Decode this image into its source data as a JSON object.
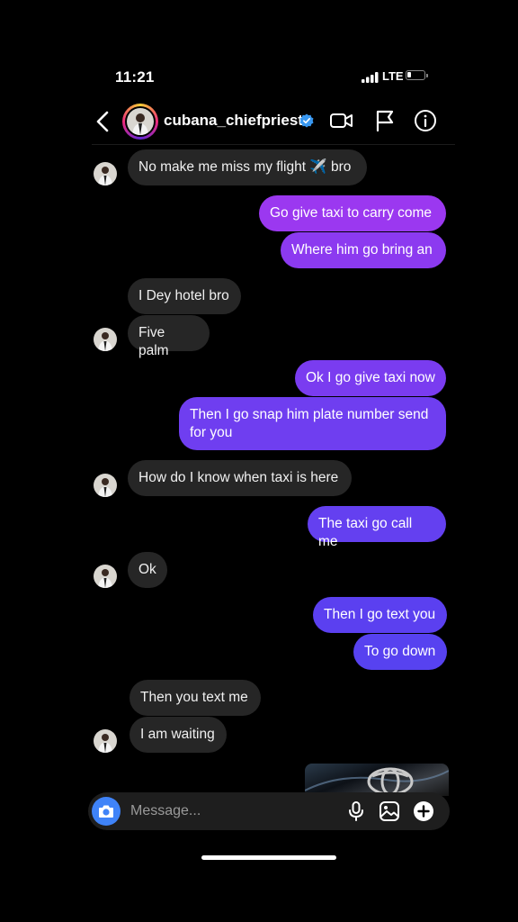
{
  "status_bar": {
    "time": "11:21",
    "network": "LTE"
  },
  "header": {
    "username": "cubana_chiefpriest"
  },
  "messages": [
    {
      "id": "m1",
      "dir": "in",
      "text": "No make me miss my flight ✈️ bro"
    },
    {
      "id": "m2",
      "dir": "out",
      "text": "Go give taxi to carry come"
    },
    {
      "id": "m3",
      "dir": "out",
      "text": "Where him go bring an"
    },
    {
      "id": "m4",
      "dir": "in",
      "text": "I Dey hotel bro"
    },
    {
      "id": "m5",
      "dir": "in",
      "text": "Five palm"
    },
    {
      "id": "m6",
      "dir": "out",
      "text": "Ok I go give taxi now"
    },
    {
      "id": "m7",
      "dir": "out",
      "text": "Then I go snap him plate number send for you"
    },
    {
      "id": "m8",
      "dir": "in",
      "text": "How do I know when taxi is here"
    },
    {
      "id": "m9",
      "dir": "out",
      "text": "The taxi go call me"
    },
    {
      "id": "m10",
      "dir": "in",
      "text": "Ok"
    },
    {
      "id": "m11",
      "dir": "out",
      "text": "Then I go text you"
    },
    {
      "id": "m12",
      "dir": "out",
      "text": "To go down"
    },
    {
      "id": "m13",
      "dir": "in",
      "text": "Then you text me"
    },
    {
      "id": "m14",
      "dir": "in",
      "text": "I am waiting"
    }
  ],
  "composer": {
    "placeholder": "Message..."
  },
  "colors": {
    "incoming": "#262626",
    "outgoing_top": "#a035f0",
    "outgoing_bottom": "#5b3ff0",
    "camera": "#3f83f8"
  },
  "icons": [
    "back-icon",
    "verified-badge-icon",
    "video-call-icon",
    "flag-icon",
    "info-icon",
    "camera-icon",
    "microphone-icon",
    "gallery-icon",
    "add-icon"
  ]
}
